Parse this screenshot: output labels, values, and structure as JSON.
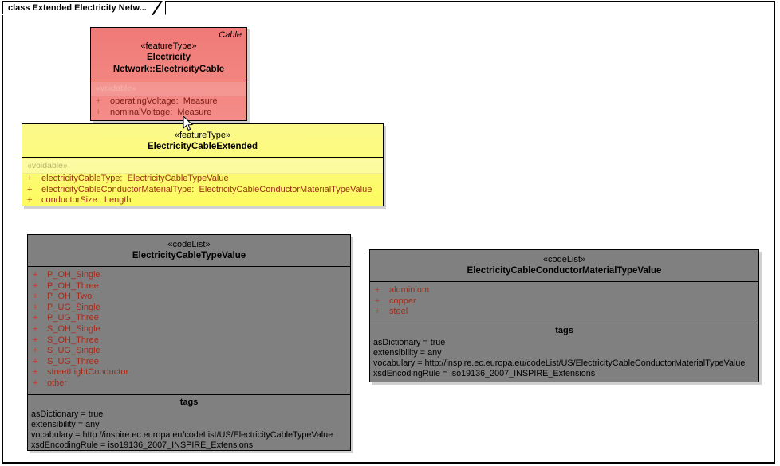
{
  "diagram": {
    "tab_label": "class Extended Electricity Netw...",
    "colors": {
      "cable_fill": "#f2837f",
      "extended_fill": "#fbf98a",
      "codelist_fill": "#808080",
      "attribute_text": "#a02020",
      "border": "#000000"
    }
  },
  "classes": {
    "cable": {
      "corner_name": "Cable",
      "stereotype": "«featureType»",
      "name": "Electricity Network::ElectricityCable",
      "voidable_label": "«voidable»",
      "attributes": [
        {
          "visibility": "+",
          "name": "operatingVoltage:",
          "type": "Measure"
        },
        {
          "visibility": "+",
          "name": "nominalVoltage:",
          "type": "Measure"
        }
      ]
    },
    "extended": {
      "stereotype": "«featureType»",
      "name": "ElectricityCableExtended",
      "voidable_label": "«voidable»",
      "attributes": [
        {
          "visibility": "+",
          "name": "electricityCableType:",
          "type": "ElectricityCableTypeValue"
        },
        {
          "visibility": "+",
          "name": "electricityCableConductorMaterialType:",
          "type": "ElectricityCableConductorMaterialTypeValue"
        },
        {
          "visibility": "+",
          "name": "conductorSize:",
          "type": "Length"
        }
      ]
    },
    "cable_type_value": {
      "stereotype": "«codeList»",
      "name": "ElectricityCableTypeValue",
      "values": [
        {
          "visibility": "+",
          "name": "P_OH_Single"
        },
        {
          "visibility": "+",
          "name": "P_OH_Three"
        },
        {
          "visibility": "+",
          "name": "P_OH_Two"
        },
        {
          "visibility": "+",
          "name": "P_UG_Single"
        },
        {
          "visibility": "+",
          "name": "P_UG_Three"
        },
        {
          "visibility": "+",
          "name": "S_OH_Single"
        },
        {
          "visibility": "+",
          "name": "S_OH_Three"
        },
        {
          "visibility": "+",
          "name": "S_UG_Single"
        },
        {
          "visibility": "+",
          "name": "S_UG_Three"
        },
        {
          "visibility": "+",
          "name": "streetLightConductor"
        },
        {
          "visibility": "+",
          "name": "other"
        }
      ],
      "tags_title": "tags",
      "tags": [
        "asDictionary = true",
        "extensibility = any",
        "vocabulary = http://inspire.ec.europa.eu/codeList/US/ElectricityCableTypeValue",
        "xsdEncodingRule = iso19136_2007_INSPIRE_Extensions"
      ]
    },
    "conductor_material_type_value": {
      "stereotype": "«codeList»",
      "name": "ElectricityCableConductorMaterialTypeValue",
      "values": [
        {
          "visibility": "+",
          "name": "aluminium"
        },
        {
          "visibility": "+",
          "name": "copper"
        },
        {
          "visibility": "+",
          "name": "steel"
        }
      ],
      "tags_title": "tags",
      "tags": [
        "asDictionary = true",
        "extensibility = any",
        "vocabulary = http://inspire.ec.europa.eu/codeList/US/ElectricityCableConductorMaterialTypeValue",
        "xsdEncodingRule = iso19136_2007_INSPIRE_Extensions"
      ]
    }
  }
}
